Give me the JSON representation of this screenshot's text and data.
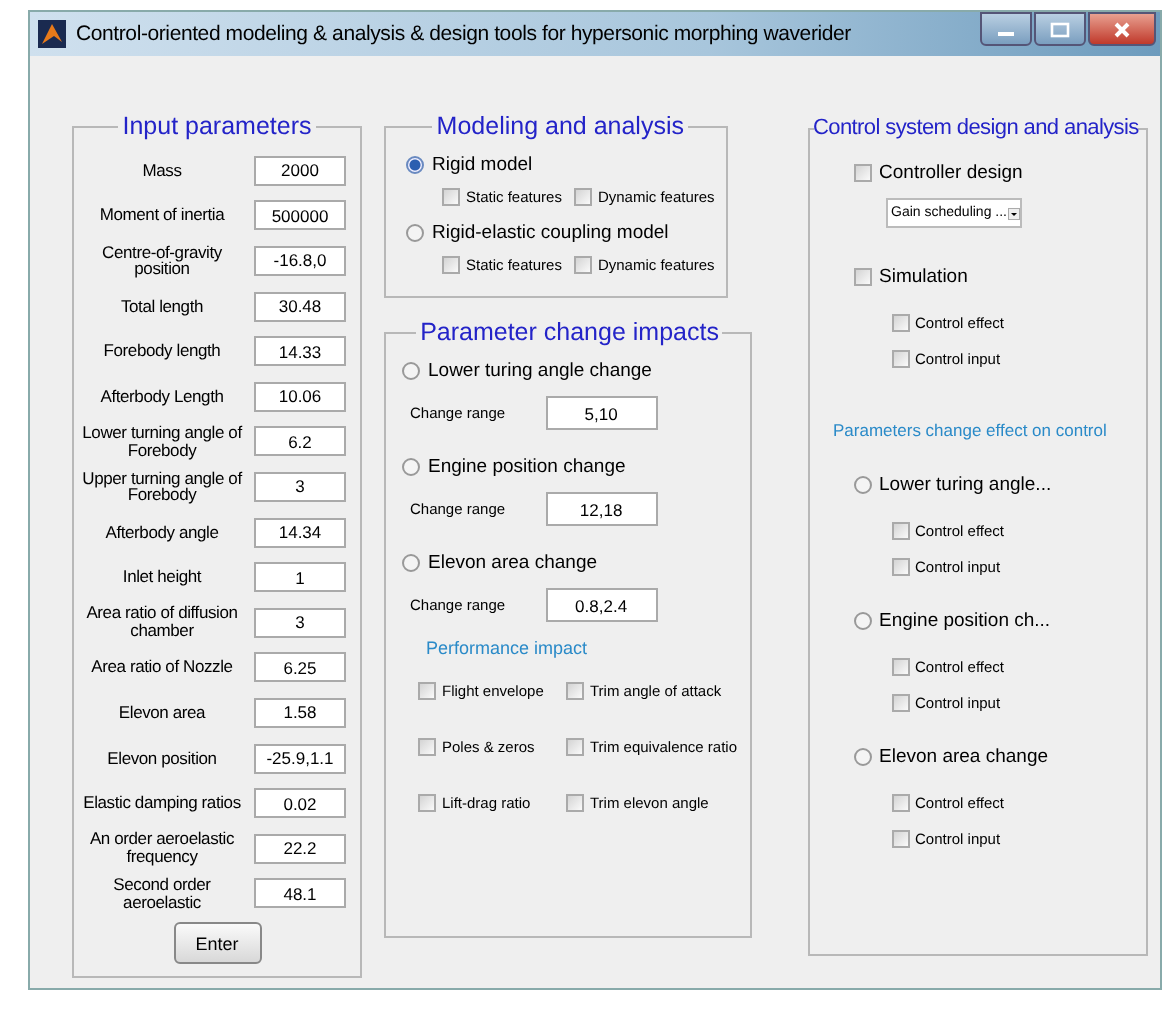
{
  "window": {
    "title": "Control-oriented modeling & analysis & design tools for hypersonic morphing waverider"
  },
  "input_parameters": {
    "title": "Input parameters",
    "fields": [
      {
        "label": "Mass",
        "value": "2000"
      },
      {
        "label": "Moment of inertia",
        "value": "500000"
      },
      {
        "label": "Centre-of-gravity position",
        "value": "-16.8,0"
      },
      {
        "label": "Total length",
        "value": "30.48"
      },
      {
        "label": "Forebody length",
        "value": "14.33"
      },
      {
        "label": "Afterbody Length",
        "value": "10.06"
      },
      {
        "label": "Lower turning angle of Forebody",
        "value": "6.2"
      },
      {
        "label": "Upper turning angle of Forebody",
        "value": "3"
      },
      {
        "label": "Afterbody angle",
        "value": "14.34"
      },
      {
        "label": "Inlet height",
        "value": "1"
      },
      {
        "label": "Area ratio of diffusion chamber",
        "value": "3"
      },
      {
        "label": "Area ratio of Nozzle",
        "value": "6.25"
      },
      {
        "label": "Elevon area",
        "value": "1.58"
      },
      {
        "label": "Elevon position",
        "value": "-25.9,1.1"
      },
      {
        "label": "Elastic damping ratios",
        "value": "0.02"
      },
      {
        "label": "An order aeroelastic frequency",
        "value": "22.2"
      },
      {
        "label": "Second order aeroelastic",
        "value": "48.1"
      }
    ],
    "button": "Enter"
  },
  "modeling": {
    "title": "Modeling and analysis",
    "models": [
      {
        "label": "Rigid model",
        "selected": true,
        "features": [
          {
            "label": "Static features",
            "checked": false
          },
          {
            "label": "Dynamic features",
            "checked": false
          }
        ]
      },
      {
        "label": "Rigid-elastic coupling model",
        "selected": false,
        "features": [
          {
            "label": "Static features",
            "checked": false
          },
          {
            "label": "Dynamic features",
            "checked": false
          }
        ]
      }
    ]
  },
  "parameter_change": {
    "title": "Parameter change impacts",
    "changes": [
      {
        "label": "Lower turing angle change",
        "selected": false,
        "range_label": "Change range",
        "range": "5,10"
      },
      {
        "label": "Engine position change",
        "selected": false,
        "range_label": "Change range",
        "range": "12,18"
      },
      {
        "label": "Elevon area change",
        "selected": false,
        "range_label": "Change range",
        "range": "0.8,2.4"
      }
    ],
    "performance_title": "Performance impact",
    "performance": [
      {
        "label": "Flight envelope",
        "checked": false
      },
      {
        "label": "Trim angle of attack",
        "checked": false
      },
      {
        "label": "Poles & zeros",
        "checked": false
      },
      {
        "label": "Trim equivalence ratio",
        "checked": false
      },
      {
        "label": "Lift-drag ratio",
        "checked": false
      },
      {
        "label": "Trim elevon angle",
        "checked": false
      }
    ]
  },
  "control": {
    "title": "Control system design and analysis",
    "controller": {
      "label": "Controller design",
      "checked": false,
      "dropdown": "Gain scheduling ..."
    },
    "simulation": {
      "label": "Simulation",
      "checked": false,
      "options": [
        {
          "label": "Control effect",
          "checked": false
        },
        {
          "label": "Control input",
          "checked": false
        }
      ]
    },
    "effect_title": "Parameters change effect on control",
    "params": [
      {
        "label": "Lower turing angle...",
        "selected": false,
        "options": [
          {
            "label": "Control effect",
            "checked": false
          },
          {
            "label": "Control input",
            "checked": false
          }
        ]
      },
      {
        "label": "Engine position ch...",
        "selected": false,
        "options": [
          {
            "label": "Control effect",
            "checked": false
          },
          {
            "label": "Control input",
            "checked": false
          }
        ]
      },
      {
        "label": "Elevon area change",
        "selected": false,
        "options": [
          {
            "label": "Control effect",
            "checked": false
          },
          {
            "label": "Control input",
            "checked": false
          }
        ]
      }
    ]
  }
}
